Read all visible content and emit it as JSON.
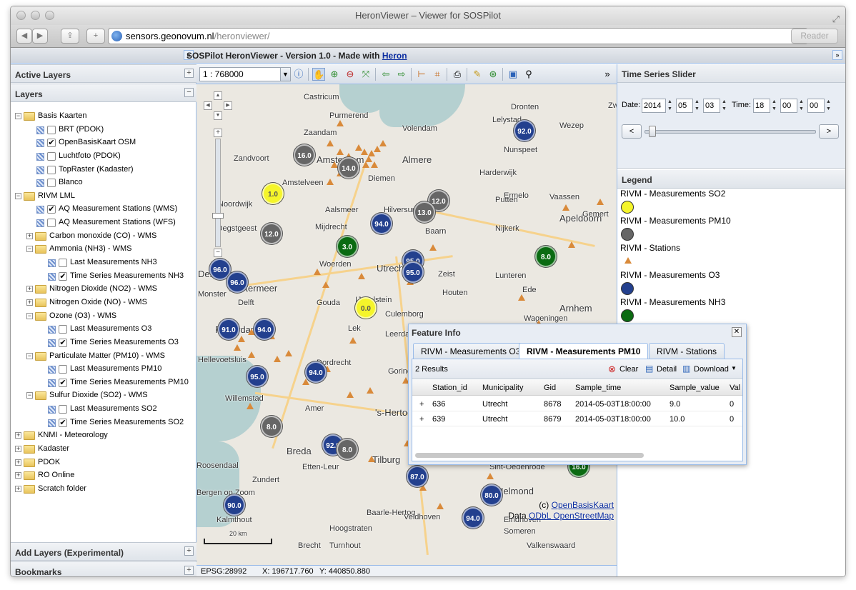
{
  "browser": {
    "title": "HeronViewer – Viewer for SOSPilot",
    "url_host": "sensors.geonovum.nl",
    "url_path": "/heronviewer/",
    "reader_label": "Reader"
  },
  "app": {
    "title_prefix": "SOSPilot HeronViewer - Version 1.0 - Made with ",
    "title_link": "Heron"
  },
  "left": {
    "active_layers": "Active Layers",
    "layers": "Layers",
    "add_layers": "Add Layers (Experimental)",
    "bookmarks": "Bookmarks",
    "tree": [
      {
        "level": 0,
        "type": "folder",
        "exp": "−",
        "label": "Basis Kaarten"
      },
      {
        "level": 1,
        "type": "layer",
        "checked": false,
        "label": "BRT (PDOK)"
      },
      {
        "level": 1,
        "type": "layer",
        "checked": true,
        "label": "OpenBasisKaart OSM"
      },
      {
        "level": 1,
        "type": "layer",
        "checked": false,
        "label": "Luchtfoto (PDOK)"
      },
      {
        "level": 1,
        "type": "layer",
        "checked": false,
        "label": "TopRaster (Kadaster)"
      },
      {
        "level": 1,
        "type": "layer",
        "checked": false,
        "label": "Blanco"
      },
      {
        "level": 0,
        "type": "folder",
        "exp": "−",
        "label": "RIVM LML"
      },
      {
        "level": 1,
        "type": "layer",
        "checked": true,
        "label": "AQ Measurement Stations (WMS)"
      },
      {
        "level": 1,
        "type": "layer",
        "checked": false,
        "label": "AQ Measurement Stations (WFS)"
      },
      {
        "level": 1,
        "type": "folder",
        "exp": "+",
        "label": "Carbon monoxide (CO) - WMS"
      },
      {
        "level": 1,
        "type": "folder",
        "exp": "−",
        "label": "Ammonia (NH3) - WMS"
      },
      {
        "level": 2,
        "type": "layer",
        "checked": false,
        "label": "Last Measurements NH3"
      },
      {
        "level": 2,
        "type": "layer",
        "checked": true,
        "label": "Time Series Measurements NH3"
      },
      {
        "level": 1,
        "type": "folder",
        "exp": "+",
        "label": "Nitrogen Dioxide (NO2) - WMS"
      },
      {
        "level": 1,
        "type": "folder",
        "exp": "+",
        "label": "Nitrogen Oxide (NO) - WMS"
      },
      {
        "level": 1,
        "type": "folder",
        "exp": "−",
        "label": "Ozone (O3) - WMS"
      },
      {
        "level": 2,
        "type": "layer",
        "checked": false,
        "label": "Last Measurements O3"
      },
      {
        "level": 2,
        "type": "layer",
        "checked": true,
        "label": "Time Series Measurements O3"
      },
      {
        "level": 1,
        "type": "folder",
        "exp": "−",
        "label": "Particulate Matter (PM10) - WMS"
      },
      {
        "level": 2,
        "type": "layer",
        "checked": false,
        "label": "Last Measurements PM10"
      },
      {
        "level": 2,
        "type": "layer",
        "checked": true,
        "label": "Time Series Measurements PM10"
      },
      {
        "level": 1,
        "type": "folder",
        "exp": "−",
        "label": "Sulfur Dioxide (SO2) - WMS"
      },
      {
        "level": 2,
        "type": "layer",
        "checked": false,
        "label": "Last Measurements SO2"
      },
      {
        "level": 2,
        "type": "layer",
        "checked": true,
        "label": "Time Series Measurements SO2"
      },
      {
        "level": 0,
        "type": "folder",
        "exp": "+",
        "label": "KNMI - Meteorology"
      },
      {
        "level": 0,
        "type": "folder",
        "exp": "+",
        "label": "Kadaster"
      },
      {
        "level": 0,
        "type": "folder",
        "exp": "+",
        "label": "PDOK"
      },
      {
        "level": 0,
        "type": "folder",
        "exp": "+",
        "label": "RO Online"
      },
      {
        "level": 0,
        "type": "folder",
        "exp": "+",
        "label": "Scratch folder"
      }
    ]
  },
  "map": {
    "scale": "1 : 768000",
    "scale_bar_label": "20 km",
    "attribution_line1_prefix": "(c) ",
    "attribution_line1_link": "OpenBasisKaart",
    "attribution_line2_prefix": "Data ",
    "attribution_line2_link": "ODbL OpenStreetMap",
    "places": [
      {
        "name": "Castricum",
        "big": false
      },
      {
        "name": "Purmerend",
        "big": false
      },
      {
        "name": "Lelystad",
        "big": false
      },
      {
        "name": "Dronten",
        "big": false
      },
      {
        "name": "Zaandam",
        "big": false
      },
      {
        "name": "Volendam",
        "big": false
      },
      {
        "name": "Zandvoort",
        "big": false
      },
      {
        "name": "Amsterdam",
        "big": true
      },
      {
        "name": "Almere",
        "big": true
      },
      {
        "name": "Harderwijk",
        "big": false
      },
      {
        "name": "Wezep",
        "big": false
      },
      {
        "name": "Diemen",
        "big": false
      },
      {
        "name": "Nunspeet",
        "big": false
      },
      {
        "name": "Ermelo",
        "big": false
      },
      {
        "name": "Amstelveen",
        "big": false
      },
      {
        "name": "Aalsmeer",
        "big": false
      },
      {
        "name": "Hilversum",
        "big": false
      },
      {
        "name": "Putten",
        "big": false
      },
      {
        "name": "Apeldoorn",
        "big": true
      },
      {
        "name": "Vaassen",
        "big": false
      },
      {
        "name": "Noordwijk",
        "big": false
      },
      {
        "name": "Oegstgeest",
        "big": false
      },
      {
        "name": "Mijdrecht",
        "big": false
      },
      {
        "name": "Baarn",
        "big": false
      },
      {
        "name": "Nijkerk",
        "big": false
      },
      {
        "name": "Woerden",
        "big": false
      },
      {
        "name": "Utrecht",
        "big": true
      },
      {
        "name": "Zeist",
        "big": false
      },
      {
        "name": "Lunteren",
        "big": false
      },
      {
        "name": "Ede",
        "big": false
      },
      {
        "name": "Den Haag",
        "big": true
      },
      {
        "name": "Zoetermeer",
        "big": true
      },
      {
        "name": "Delft",
        "big": false
      },
      {
        "name": "Gouda",
        "big": false
      },
      {
        "name": "IJsselstein",
        "big": false
      },
      {
        "name": "Houten",
        "big": false
      },
      {
        "name": "Arnhem",
        "big": true
      },
      {
        "name": "Monster",
        "big": false
      },
      {
        "name": "Culemborg",
        "big": false
      },
      {
        "name": "Wageningen",
        "big": false
      },
      {
        "name": "Rotterdam",
        "big": true
      },
      {
        "name": "Lek",
        "big": false
      },
      {
        "name": "Leerdam",
        "big": false
      },
      {
        "name": "Hellevoetsluis",
        "big": false
      },
      {
        "name": "Dordrecht",
        "big": false
      },
      {
        "name": "Gorinchem",
        "big": false
      },
      {
        "name": "Willemstad",
        "big": false
      },
      {
        "name": "Amer",
        "big": false
      },
      {
        "name": "'s-Hertogenbosch",
        "big": true
      },
      {
        "name": "Breda",
        "big": true
      },
      {
        "name": "Tilburg",
        "big": true
      },
      {
        "name": "Roosendaal",
        "big": false
      },
      {
        "name": "Etten-Leur",
        "big": false
      },
      {
        "name": "Sint-Oedenrode",
        "big": false
      },
      {
        "name": "Bergen op Zoom",
        "big": false
      },
      {
        "name": "Helmond",
        "big": true
      },
      {
        "name": "Kalmthout",
        "big": false
      },
      {
        "name": "Baarle-Hertog",
        "big": false
      },
      {
        "name": "Hoogstraten",
        "big": false
      },
      {
        "name": "Eindhoven",
        "big": false
      },
      {
        "name": "Someren",
        "big": false
      },
      {
        "name": "Brecht",
        "big": false
      },
      {
        "name": "Turnhout",
        "big": false
      },
      {
        "name": "Valkenswaard",
        "big": false
      },
      {
        "name": "Gemert",
        "big": false
      },
      {
        "name": "Zwolle",
        "big": false
      },
      {
        "name": "Veldhoven",
        "big": false
      },
      {
        "name": "Zundert",
        "big": false
      }
    ],
    "markers": [
      {
        "value": "92.0",
        "color": "#23408e"
      },
      {
        "value": "16.0",
        "color": "#666666"
      },
      {
        "value": "14.0",
        "color": "#666666"
      },
      {
        "value": "1.0",
        "color": "#f5f52a"
      },
      {
        "value": "12.0",
        "color": "#666666"
      },
      {
        "value": "13.0",
        "color": "#666666"
      },
      {
        "value": "94.0",
        "color": "#23408e"
      },
      {
        "value": "12.0",
        "color": "#666666"
      },
      {
        "value": "3.0",
        "color": "#0b6b12"
      },
      {
        "value": "8.0",
        "color": "#0b6b12"
      },
      {
        "value": "95.0",
        "color": "#23408e"
      },
      {
        "value": "96.0",
        "color": "#23408e"
      },
      {
        "value": "95.0",
        "color": "#23408e"
      },
      {
        "value": "96.0",
        "color": "#23408e"
      },
      {
        "value": "0.0",
        "color": "#f5f52a"
      },
      {
        "value": "91.0",
        "color": "#23408e"
      },
      {
        "value": "94.0",
        "color": "#23408e"
      },
      {
        "value": "95.0",
        "color": "#23408e"
      },
      {
        "value": "94.0",
        "color": "#23408e"
      },
      {
        "value": "8.0",
        "color": "#666666"
      },
      {
        "value": "92.0",
        "color": "#23408e"
      },
      {
        "value": "87.0",
        "color": "#23408e"
      },
      {
        "value": "16.0",
        "color": "#0b6b12"
      },
      {
        "value": "80.0",
        "color": "#23408e"
      },
      {
        "value": "90.0",
        "color": "#23408e"
      },
      {
        "value": "94.0",
        "color": "#23408e"
      },
      {
        "value": "8.0",
        "color": "#666666"
      }
    ]
  },
  "status": {
    "projection": "EPSG:28992",
    "x": "X: 196717.760",
    "y": "Y: 440850.880"
  },
  "time_slider": {
    "title": "Time Series Slider",
    "date_label": "Date:",
    "year": "2014",
    "month": "05",
    "day": "03",
    "time_label": "Time:",
    "hour": "18",
    "minute": "00",
    "second": "00",
    "prev": "<",
    "next": ">"
  },
  "legend": {
    "title": "Legend",
    "items": [
      {
        "label": "RIVM - Measurements SO2",
        "symbol": "circle",
        "color": "#f5f52a"
      },
      {
        "label": "RIVM - Measurements PM10",
        "symbol": "circle",
        "color": "#666666"
      },
      {
        "label": "RIVM - Stations",
        "symbol": "triangle",
        "color": "#d98a3a"
      },
      {
        "label": "RIVM - Measurements O3",
        "symbol": "circle",
        "color": "#23408e"
      },
      {
        "label": "RIVM - Measurements NH3",
        "symbol": "circle",
        "color": "#0b6b12"
      }
    ]
  },
  "feature_info": {
    "title": "Feature Info",
    "tabs": [
      "RIVM - Measurements O3",
      "RIVM - Measurements PM10",
      "RIVM - Stations"
    ],
    "active_tab": 1,
    "results": "2 Results",
    "clear": "Clear",
    "detail": "Detail",
    "download": "Download",
    "columns": [
      "Station_id",
      "Municipality",
      "Gid",
      "Sample_time",
      "Sample_value",
      "Val"
    ],
    "rows": [
      [
        "636",
        "Utrecht",
        "8678",
        "2014-05-03T18:00:00",
        "9.0",
        "0"
      ],
      [
        "639",
        "Utrecht",
        "8679",
        "2014-05-03T18:00:00",
        "10.0",
        "0"
      ]
    ]
  }
}
